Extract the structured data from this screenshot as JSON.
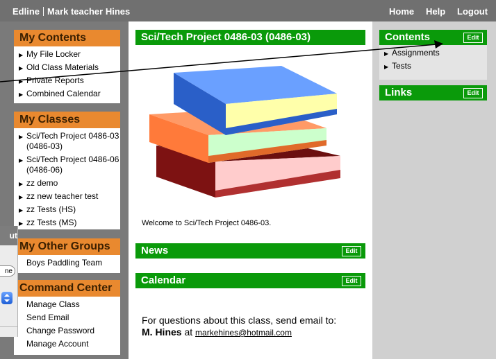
{
  "topbar": {
    "brand": "Edline",
    "user": "Mark teacher Hines",
    "home": "Home",
    "help": "Help",
    "logout": "Logout"
  },
  "left": {
    "my_contents": {
      "title": "My Contents",
      "items": [
        "My File Locker",
        "Old Class Materials",
        "Private Reports",
        "Combined Calendar"
      ]
    },
    "my_classes": {
      "title": "My Classes",
      "items": [
        "Sci/Tech Project 0486-03 (0486-03)",
        "Sci/Tech Project 0486-06 (0486-06)",
        "zz demo",
        "zz new teacher test",
        "zz Tests (HS)",
        "zz Tests (MS)"
      ]
    },
    "my_other_groups": {
      "title": "My Other Groups",
      "items": [
        "Boys Paddling Team"
      ]
    },
    "command_center": {
      "title": "Command Center",
      "items": [
        "Manage Class",
        "Send Email",
        "Change Password",
        "Manage Account"
      ]
    }
  },
  "main": {
    "title": "Sci/Tech Project 0486-03 (0486-03)",
    "welcome": "Welcome to Sci/Tech Project 0486-03.",
    "news": "News",
    "calendar": "Calendar",
    "edit": "Edit",
    "contact_text": "For questions about this class, send email to:",
    "contact_name": "M. Hines",
    "contact_at": "at",
    "contact_email": "markehines@hotmail.com"
  },
  "right": {
    "contents": {
      "title": "Contents",
      "items": [
        "Assignments",
        "Tests"
      ]
    },
    "links": {
      "title": "Links"
    },
    "edit": "Edit"
  },
  "dialog": {
    "title": "ut",
    "pill": "ne"
  },
  "colors": {
    "topbar": "#707070",
    "orange_header": "#e9892f",
    "green_header": "#0a9a0a",
    "right_bg": "#d0d0d0"
  }
}
